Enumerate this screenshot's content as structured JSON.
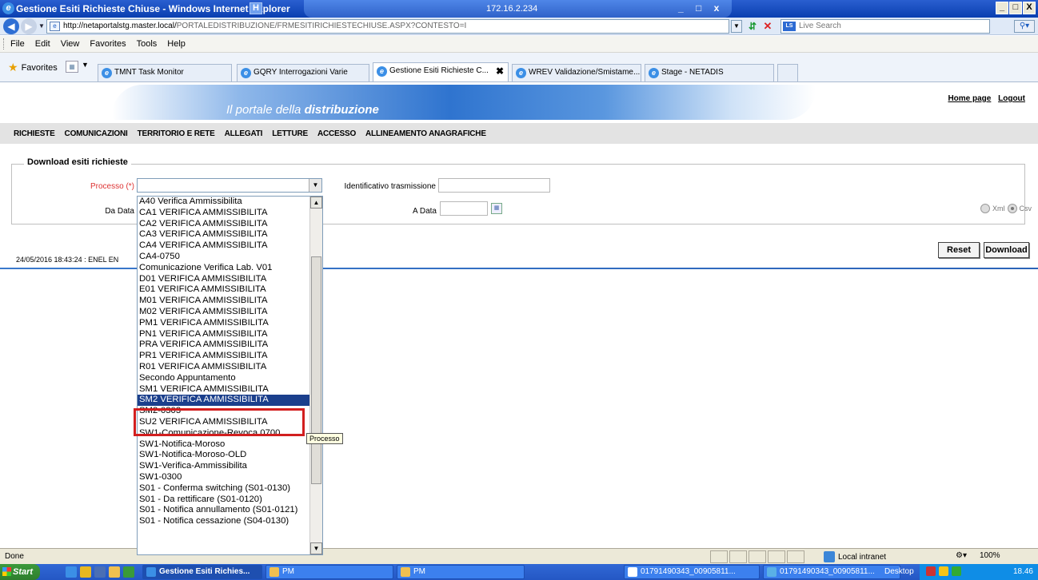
{
  "window": {
    "title": "Gestione Esiti Richieste Chiuse - Windows Internet Explorer",
    "ip": "172.16.2.234",
    "controls": [
      "_",
      "□",
      "x"
    ],
    "frame_controls": [
      "_",
      "□",
      "X"
    ]
  },
  "address": {
    "url_host": "http://netaportalstg.master.local/",
    "url_path": "PORTALEDISTRIBUZIONE/FRMESITIRICHIESTECHIUSE.ASPX?CONTESTO=I",
    "search_placeholder": "Live Search"
  },
  "menu": [
    "File",
    "Edit",
    "View",
    "Favorites",
    "Tools",
    "Help"
  ],
  "favorites_label": "Favorites",
  "tabs": [
    {
      "label": "TMNT Task Monitor"
    },
    {
      "label": "GQRY Interrogazioni Varie"
    },
    {
      "label": "Gestione Esiti Richieste C...",
      "active": true
    },
    {
      "label": "WREV Validazione/Smistame..."
    },
    {
      "label": "Stage - NETADIS"
    }
  ],
  "banner": {
    "slogan_prefix": "Il portale della ",
    "slogan_bold": "distribuzione",
    "links": [
      "Home page",
      "Logout"
    ]
  },
  "nav": [
    "RICHIESTE",
    "COMUNICAZIONI",
    "TERRITORIO E RETE",
    "ALLEGATI",
    "LETTURE",
    "ACCESSO",
    "ALLINEAMENTO ANAGRAFICHE"
  ],
  "form": {
    "legend": "Download esiti richieste",
    "processo_label": "Processo (*)",
    "id_trasmissione_label": "Identificativo trasmissione",
    "da_data_label": "Da Data",
    "a_data_label": "A Data",
    "xml_label": "Xml",
    "csv_label": "Csv",
    "selected_format": "Csv",
    "reset_label": "Reset",
    "download_label": "Download"
  },
  "status_line": "24/05/2016 18:43:24  :  ENEL EN",
  "dropdown": {
    "items": [
      "A40 Verifica Ammissibilita",
      "CA1 VERIFICA AMMISSIBILITA",
      "CA2 VERIFICA AMMISSIBILITA",
      "CA3 VERIFICA AMMISSIBILITA",
      "CA4 VERIFICA AMMISSIBILITA",
      "CA4-0750",
      "Comunicazione Verifica Lab. V01",
      "D01 VERIFICA AMMISSIBILITA",
      "E01 VERIFICA AMMISSIBILITA",
      "M01 VERIFICA AMMISSIBILITA",
      "M02 VERIFICA AMMISSIBILITA",
      "PM1 VERIFICA AMMISSIBILITA",
      "PN1 VERIFICA AMMISSIBILITA",
      "PRA VERIFICA AMMISSIBILITA",
      "PR1 VERIFICA AMMISSIBILITA",
      "R01 VERIFICA AMMISSIBILITA",
      "Secondo Appuntamento",
      "SM1 VERIFICA AMMISSIBILITA",
      "SM2 VERIFICA AMMISSIBILITA",
      "SM2-0303",
      "SU2 VERIFICA AMMISSIBILITA",
      "SW1-Comunicazione-Revoca 0700",
      "SW1-Notifica-Moroso",
      "SW1-Notifica-Moroso-OLD",
      "SW1-Verifica-Ammissibilita",
      "SW1-0300",
      "S01 - Conferma switching (S01-0130)",
      "S01 - Da rettificare (S01-0120)",
      "S01 - Notifica annullamento (S01-0121)",
      "S01 - Notifica cessazione (S04-0130)"
    ],
    "selected_index": 18,
    "tooltip": "Processo"
  },
  "statusbar": {
    "left": "Done",
    "zone": "Local intranet",
    "zoom": "100%"
  },
  "taskbar": {
    "start": "Start",
    "tasks": [
      "Gestione Esiti Richies...",
      "PM",
      "PM",
      "01791490343_00905811...",
      "01791490343_00905811..."
    ],
    "desktop": "Desktop",
    "clock": "18.46"
  }
}
